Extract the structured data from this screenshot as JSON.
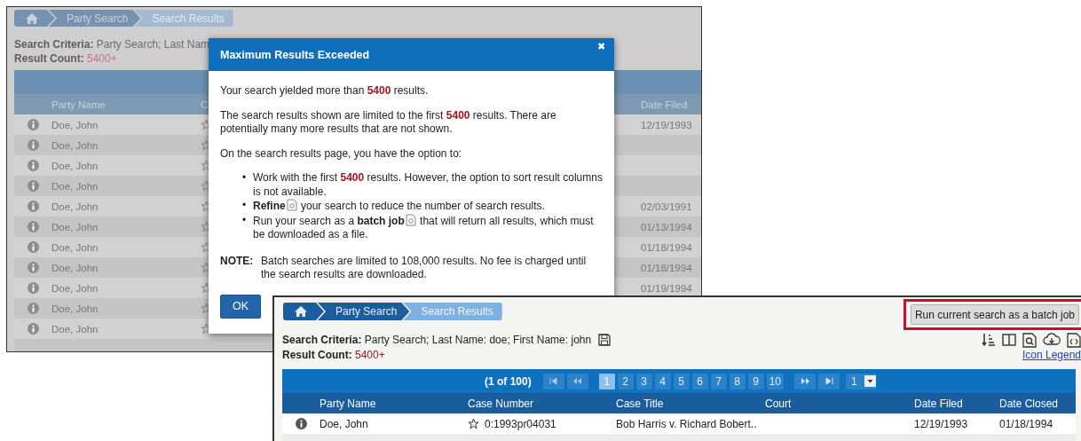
{
  "background_page": {
    "breadcrumb": [
      {
        "kind": "home",
        "selected": false
      },
      {
        "kind": "crumb",
        "label": "Party Search",
        "selected": false
      },
      {
        "kind": "crumb",
        "label": "Search Results",
        "selected": true
      }
    ],
    "criteria_label": "Search Criteria:",
    "criteria_value": "Party Search; Last Nam",
    "count_label": "Result Count:",
    "count_value": "5400+",
    "columns": [
      "Party Name",
      "C",
      "Date Filed"
    ],
    "rows": [
      {
        "party": "Doe, John",
        "date_filed": "12/19/1993"
      },
      {
        "party": "Doe, John"
      },
      {
        "party": "Doe, John"
      },
      {
        "party": "Doe, John"
      },
      {
        "party": "Doe, John",
        "date_filed": "02/03/1991"
      },
      {
        "party": "Doe, John",
        "date_filed": "01/13/1994"
      },
      {
        "party": "Doe, John",
        "date_filed": "01/18/1994"
      },
      {
        "party": "Doe, John",
        "date_filed": "01/18/1994"
      },
      {
        "party": "Doe, John",
        "date_filed": "01/19/1994"
      },
      {
        "party": "Doe, John"
      },
      {
        "party": "Doe, John"
      }
    ]
  },
  "dialog": {
    "title": "Maximum Results Exceeded",
    "close": "✖",
    "paragraphs": [
      [
        {
          "kind": "plain",
          "text": "Your search yielded more than "
        },
        {
          "kind": "count",
          "text": "5400"
        },
        {
          "kind": "plain",
          "text": " results."
        }
      ],
      [
        {
          "kind": "plain",
          "text": "The search results shown are limited to the first "
        },
        {
          "kind": "count",
          "text": "5400"
        },
        {
          "kind": "plain",
          "text": " results. There are potentially many more results that are not shown."
        }
      ],
      [
        {
          "kind": "plain",
          "text": "On the search results page, you have the option to:"
        }
      ]
    ],
    "bullets": [
      {
        "marker": "•",
        "segments": [
          {
            "kind": "plain",
            "text": "Work with the first "
          },
          {
            "kind": "count",
            "text": "5400"
          },
          {
            "kind": "plain",
            "text": " results. However, the option to sort result columns is not available."
          }
        ]
      },
      {
        "marker": "•",
        "segments": [
          {
            "kind": "strong",
            "text": "Refine"
          },
          {
            "kind": "icon"
          },
          {
            "kind": "plain",
            "text": " your search to reduce the number of search results."
          }
        ]
      },
      {
        "marker": "•",
        "segments": [
          {
            "kind": "plain",
            "text": "Run your search as a "
          },
          {
            "kind": "strong",
            "text": "batch job"
          },
          {
            "kind": "icon"
          },
          {
            "kind": "plain",
            "text": " that will return all results, which must be downloaded as a file."
          }
        ]
      }
    ],
    "note_label": "NOTE:",
    "note_text": "Batch searches are limited to 108,000 results. No fee is charged until the search results are downloaded.",
    "ok_button": "OK"
  },
  "front_page": {
    "breadcrumb": [
      {
        "kind": "home",
        "selected": false
      },
      {
        "kind": "crumb",
        "label": "Party Search",
        "selected": false
      },
      {
        "kind": "crumb",
        "label": "Search Results",
        "selected": true
      }
    ],
    "batch_button": {
      "label": "Run current search as a batch job",
      "highlighted": true
    },
    "criteria_label": "Search Criteria:",
    "criteria_value": "Party Search; Last Name: doe; First Name: john",
    "count_label": "Result Count:",
    "count_value": "5400+",
    "icon_legend": "Icon Legend",
    "pager": {
      "summary": "(1 of 100)",
      "pages": [
        {
          "label": "1",
          "selected": true
        },
        {
          "label": "2",
          "selected": false
        },
        {
          "label": "3",
          "selected": false
        },
        {
          "label": "4",
          "selected": false
        },
        {
          "label": "5",
          "selected": false
        },
        {
          "label": "6",
          "selected": false
        },
        {
          "label": "7",
          "selected": false
        },
        {
          "label": "8",
          "selected": false
        },
        {
          "label": "9",
          "selected": false
        },
        {
          "label": "10",
          "selected": false
        }
      ],
      "page_select": "1"
    },
    "columns": [
      "Party Name",
      "Case Number",
      "Case Title",
      "Court",
      "Date Filed",
      "Date Closed"
    ],
    "rows": [
      {
        "party": "Doe, John",
        "case_number": "0:1993pr04031",
        "case_title": "Bob Harris v. Richard Bobert..",
        "date_filed": "12/19/1993",
        "date_closed": "01/18/1994"
      }
    ]
  }
}
